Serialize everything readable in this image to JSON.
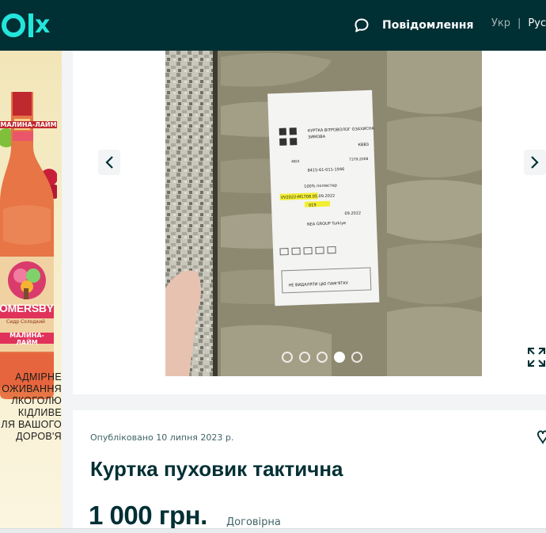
{
  "header": {
    "logo_text": "olx",
    "messages_label": "Повідомлення",
    "lang_ukr": "Укр",
    "lang_separator": "|",
    "lang_rus": "Рус"
  },
  "ad": {
    "brand": "SOMERSBY",
    "bottle_label_top": "МАЛИНА-ЛАЙМ",
    "bottle_label_bottom": "МАЛИНА-ЛАЙМ",
    "bottle_small": "Сидр Солодкий",
    "warning": "АДМІРНЕ\nОЖИВАННЯ\nЛКОГОЛЮ\nКІДЛИВЕ\nЛЯ ВАШОГО\nДОРОВ'Я"
  },
  "gallery": {
    "total_images": 5,
    "active_index": 3,
    "label": {
      "line1": "КУРТКА ВІТРОВОЛОГ ОЗАХИСНА",
      "line2": "ЗИМОВА",
      "code": "КВВЗ",
      "size": "48/4",
      "spec": "7379.2008",
      "nsn": "8415-61-011-1946",
      "fabric": "100% поліестер",
      "batch": "VV2022-М1708 05.09.2022",
      "num": "019",
      "date": "09.2022",
      "maker": "NEA GROUP Turkiye",
      "note": "НЕ ВИДАЛЯТИ ЦЮ ПАМ'ЯТКУ"
    }
  },
  "listing": {
    "published": "Опубліковано 10 липня 2023 р.",
    "title": "Куртка пуховик тактична",
    "price": "1 000 грн.",
    "negotiable": "Договірна"
  },
  "colors": {
    "header_bg": "#002f34",
    "logo": "#23e5db",
    "text_dark": "#002f34",
    "text_muted": "#406367"
  }
}
